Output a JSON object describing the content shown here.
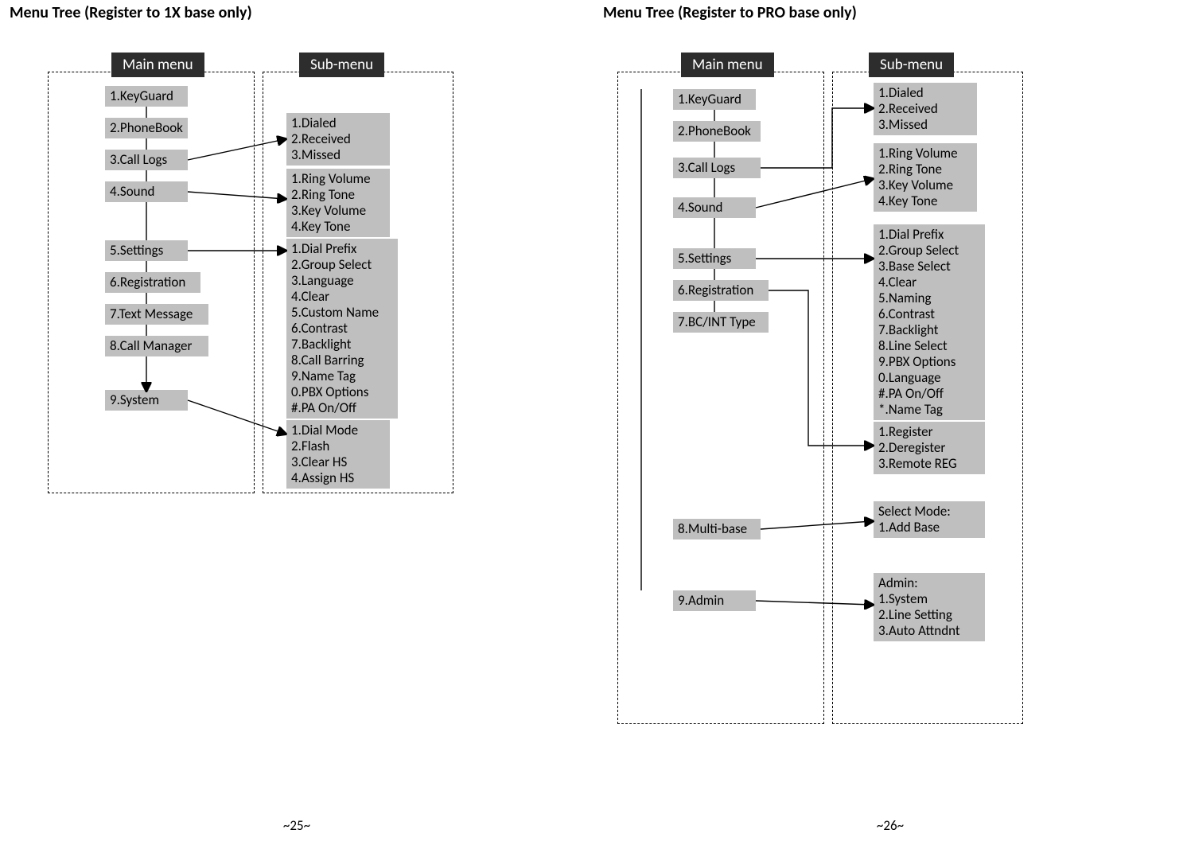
{
  "left": {
    "title": "Menu Tree (Register to 1X base only)",
    "mainHeader": "Main menu",
    "subHeader": "Sub-menu",
    "main": {
      "m1": "1.KeyGuard",
      "m2": "2.PhoneBook",
      "m3": "3.Call Logs",
      "m4": "4.Sound",
      "m5": "5.Settings",
      "m6": "6.Registration",
      "m7": "7.Text Message",
      "m8": "8.Call Manager",
      "m9": "9.System"
    },
    "sub": {
      "s3": "1.Dialed\n2.Received\n3.Missed",
      "s4": "1.Ring Volume\n2.Ring Tone\n3.Key Volume\n4.Key Tone",
      "s5": "1.Dial Prefix\n2.Group Select\n3.Language\n4.Clear\n5.Custom Name\n6.Contrast\n7.Backlight\n8.Call Barring\n9.Name Tag\n0.PBX Options\n#.PA On/Off",
      "s9": "1.Dial Mode\n2.Flash\n3.Clear HS\n4.Assign HS"
    },
    "pageNum": "~25~"
  },
  "right": {
    "title": "Menu Tree (Register to PRO base only)",
    "mainHeader": "Main menu",
    "subHeader": "Sub-menu",
    "main": {
      "m1": "1.KeyGuard",
      "m2": "2.PhoneBook",
      "m3": "3.Call Logs",
      "m4": "4.Sound",
      "m5": "5.Settings",
      "m6": "6.Registration",
      "m7": "7.BC/INT Type",
      "m8": "8.Multi-base",
      "m9": "9.Admin"
    },
    "sub": {
      "s3": "1.Dialed\n2.Received\n3.Missed",
      "s4": "1.Ring Volume\n2.Ring Tone\n3.Key Volume\n4.Key Tone",
      "s5": "1.Dial Prefix\n2.Group Select\n3.Base Select\n4.Clear\n5.Naming\n6.Contrast\n7.Backlight\n8.Line Select\n9.PBX Options\n0.Language\n#.PA On/Off\n*.Name Tag",
      "s6": "1.Register\n2.Deregister\n3.Remote REG",
      "s8": "Select Mode:\n1.Add Base",
      "s9": "Admin:\n1.System\n2.Line Setting\n3.Auto Attndnt"
    },
    "pageNum": "~26~"
  }
}
